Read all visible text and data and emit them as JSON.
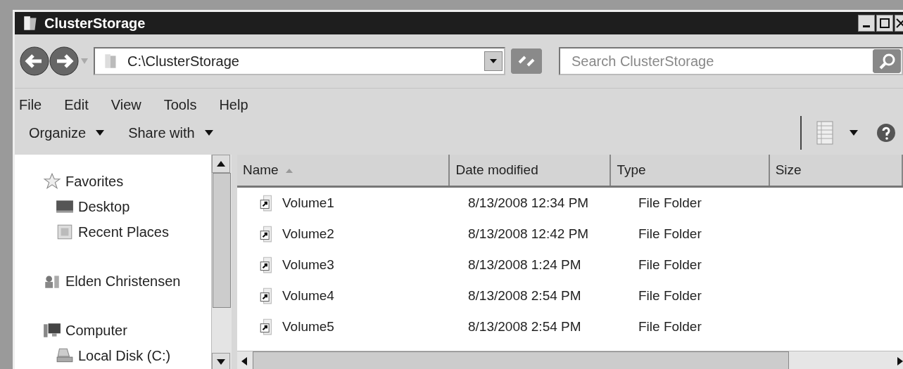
{
  "window": {
    "title": "ClusterStorage"
  },
  "address": {
    "value": "C:\\ClusterStorage"
  },
  "search": {
    "placeholder": "Search ClusterStorage"
  },
  "menu": [
    "File",
    "Edit",
    "View",
    "Tools",
    "Help"
  ],
  "toolbar": [
    "Organize",
    "Share with"
  ],
  "sidebar": {
    "items": [
      {
        "label": "Favorites",
        "children": [
          {
            "label": "Desktop"
          },
          {
            "label": "Recent Places"
          }
        ]
      },
      {
        "label": "Elden Christensen"
      },
      {
        "label": "Computer",
        "children": [
          {
            "label": "Local Disk (C:)"
          }
        ]
      }
    ]
  },
  "table": {
    "columns": [
      {
        "label": "Name",
        "sorted": true
      },
      {
        "label": "Date modified",
        "sorted": false
      },
      {
        "label": "Type",
        "sorted": false
      },
      {
        "label": "Size",
        "sorted": false
      }
    ],
    "rows": [
      [
        "Volume1",
        "8/13/2008 12:34 PM",
        "File Folder"
      ],
      [
        "Volume2",
        "8/13/2008 12:42 PM",
        "File Folder"
      ],
      [
        "Volume3",
        "8/13/2008 1:24 PM",
        "File Folder"
      ],
      [
        "Volume4",
        "8/13/2008 2:54 PM",
        "File Folder"
      ],
      [
        "Volume5",
        "8/13/2008 2:54 PM",
        "File Folder"
      ]
    ]
  }
}
